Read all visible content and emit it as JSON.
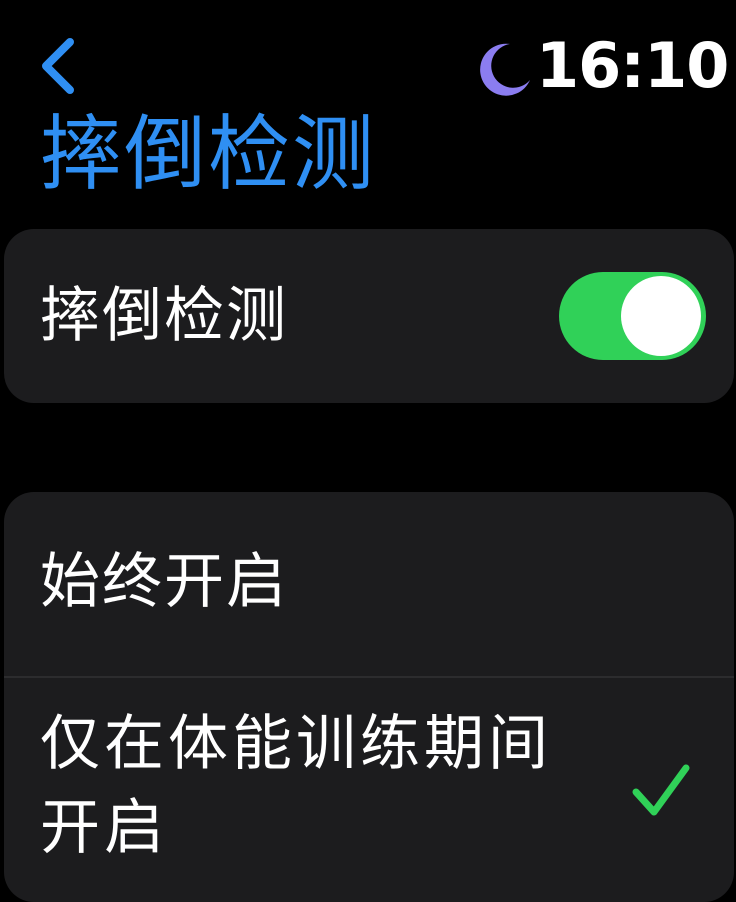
{
  "status_bar": {
    "time": "16:10",
    "focus_icon": "moon-icon",
    "back_icon": "chevron-left-icon"
  },
  "title": "摔倒检测",
  "toggle": {
    "label": "摔倒检测",
    "state": "on"
  },
  "options": [
    {
      "label": "始终开启",
      "selected": false
    },
    {
      "label": "仅在体能训练期间开启",
      "selected": true,
      "indicator_icon": "checkmark-icon"
    }
  ],
  "colors": {
    "background": "#000000",
    "card": "#1c1c1e",
    "title_accent": "#2f8ff3",
    "toggle_on": "#30d158",
    "moon": "#8b7df0",
    "checkmark": "#30d158"
  }
}
